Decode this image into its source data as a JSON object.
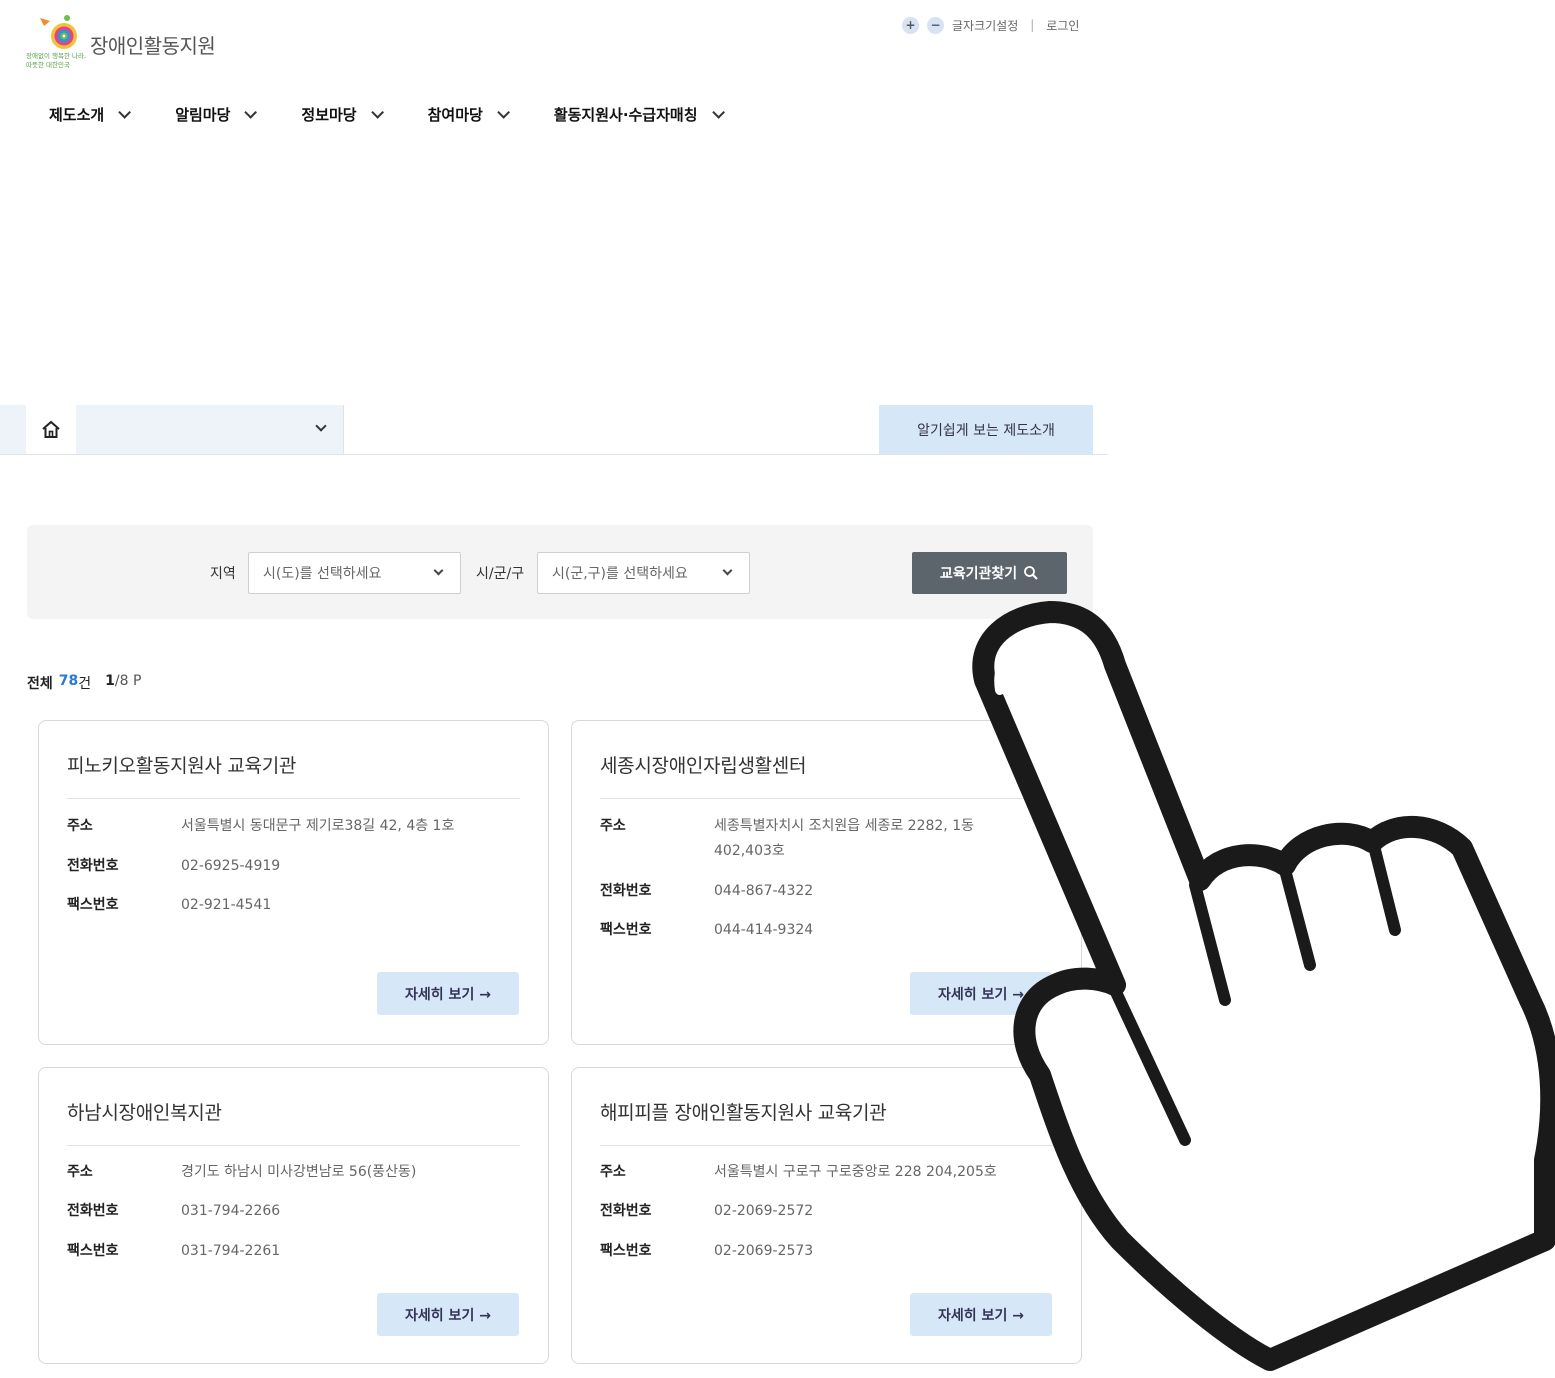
{
  "header": {
    "logo_title": "장애인활동지원",
    "logo_sub_line1": "장애없이 행복한 나라,",
    "logo_sub_line2": "따뜻한 대한민국",
    "font_plus": "+",
    "font_minus": "−",
    "font_setting_label": "글자크기설정",
    "separator": "|",
    "login_label": "로그인"
  },
  "gnb": {
    "items": [
      {
        "label": "제도소개"
      },
      {
        "label": "알림마당"
      },
      {
        "label": "정보마당"
      },
      {
        "label": "참여마당"
      },
      {
        "label": "활동지원사·수급자매칭"
      }
    ]
  },
  "subnav": {
    "home_icon": "home-icon",
    "depth_value": "",
    "easy_intro_label": "알기쉽게 보는 제도소개"
  },
  "search": {
    "region_label": "지역",
    "region_placeholder": "시(도)를 선택하세요",
    "city_label": "시/군/구",
    "city_placeholder": "시(군,구)를 선택하세요",
    "search_button": "교육기관찾기",
    "search_icon": "search-icon"
  },
  "summary": {
    "total_label": "전체",
    "total_count": "78",
    "count_unit": "건",
    "page_current": "1",
    "page_rest": "/8 P"
  },
  "labels": {
    "address": "주소",
    "phone": "전화번호",
    "fax": "팩스번호",
    "more": "자세히 보기 →"
  },
  "cards": [
    {
      "name": "피노키오활동지원사 교육기관",
      "address": "서울특별시 동대문구 제기로38길 42, 4층 1호",
      "phone": "02-6925-4919",
      "fax": "02-921-4541"
    },
    {
      "name": "세종시장애인자립생활센터",
      "address": "세종특별자치시 조치원읍 세종로 2282, 1동 402,403호",
      "phone": "044-867-4322",
      "fax": "044-414-9324"
    },
    {
      "name": "하남시장애인복지관",
      "address": "경기도 하남시 미사강변남로 56(풍산동)",
      "phone": "031-794-2266",
      "fax": "031-794-2261"
    },
    {
      "name": "해피피플 장애인활동지원사 교육기관",
      "address": "서울특별시 구로구 구로중앙로 228 204,205호",
      "phone": "02-2069-2572",
      "fax": "02-2069-2573"
    }
  ],
  "overlay": {
    "icon": "pointing-hand-icon"
  },
  "colors": {
    "accent_blue": "#2a7bd0",
    "button_light_blue": "#d6e8f8",
    "search_button_gray": "#5c646c"
  }
}
